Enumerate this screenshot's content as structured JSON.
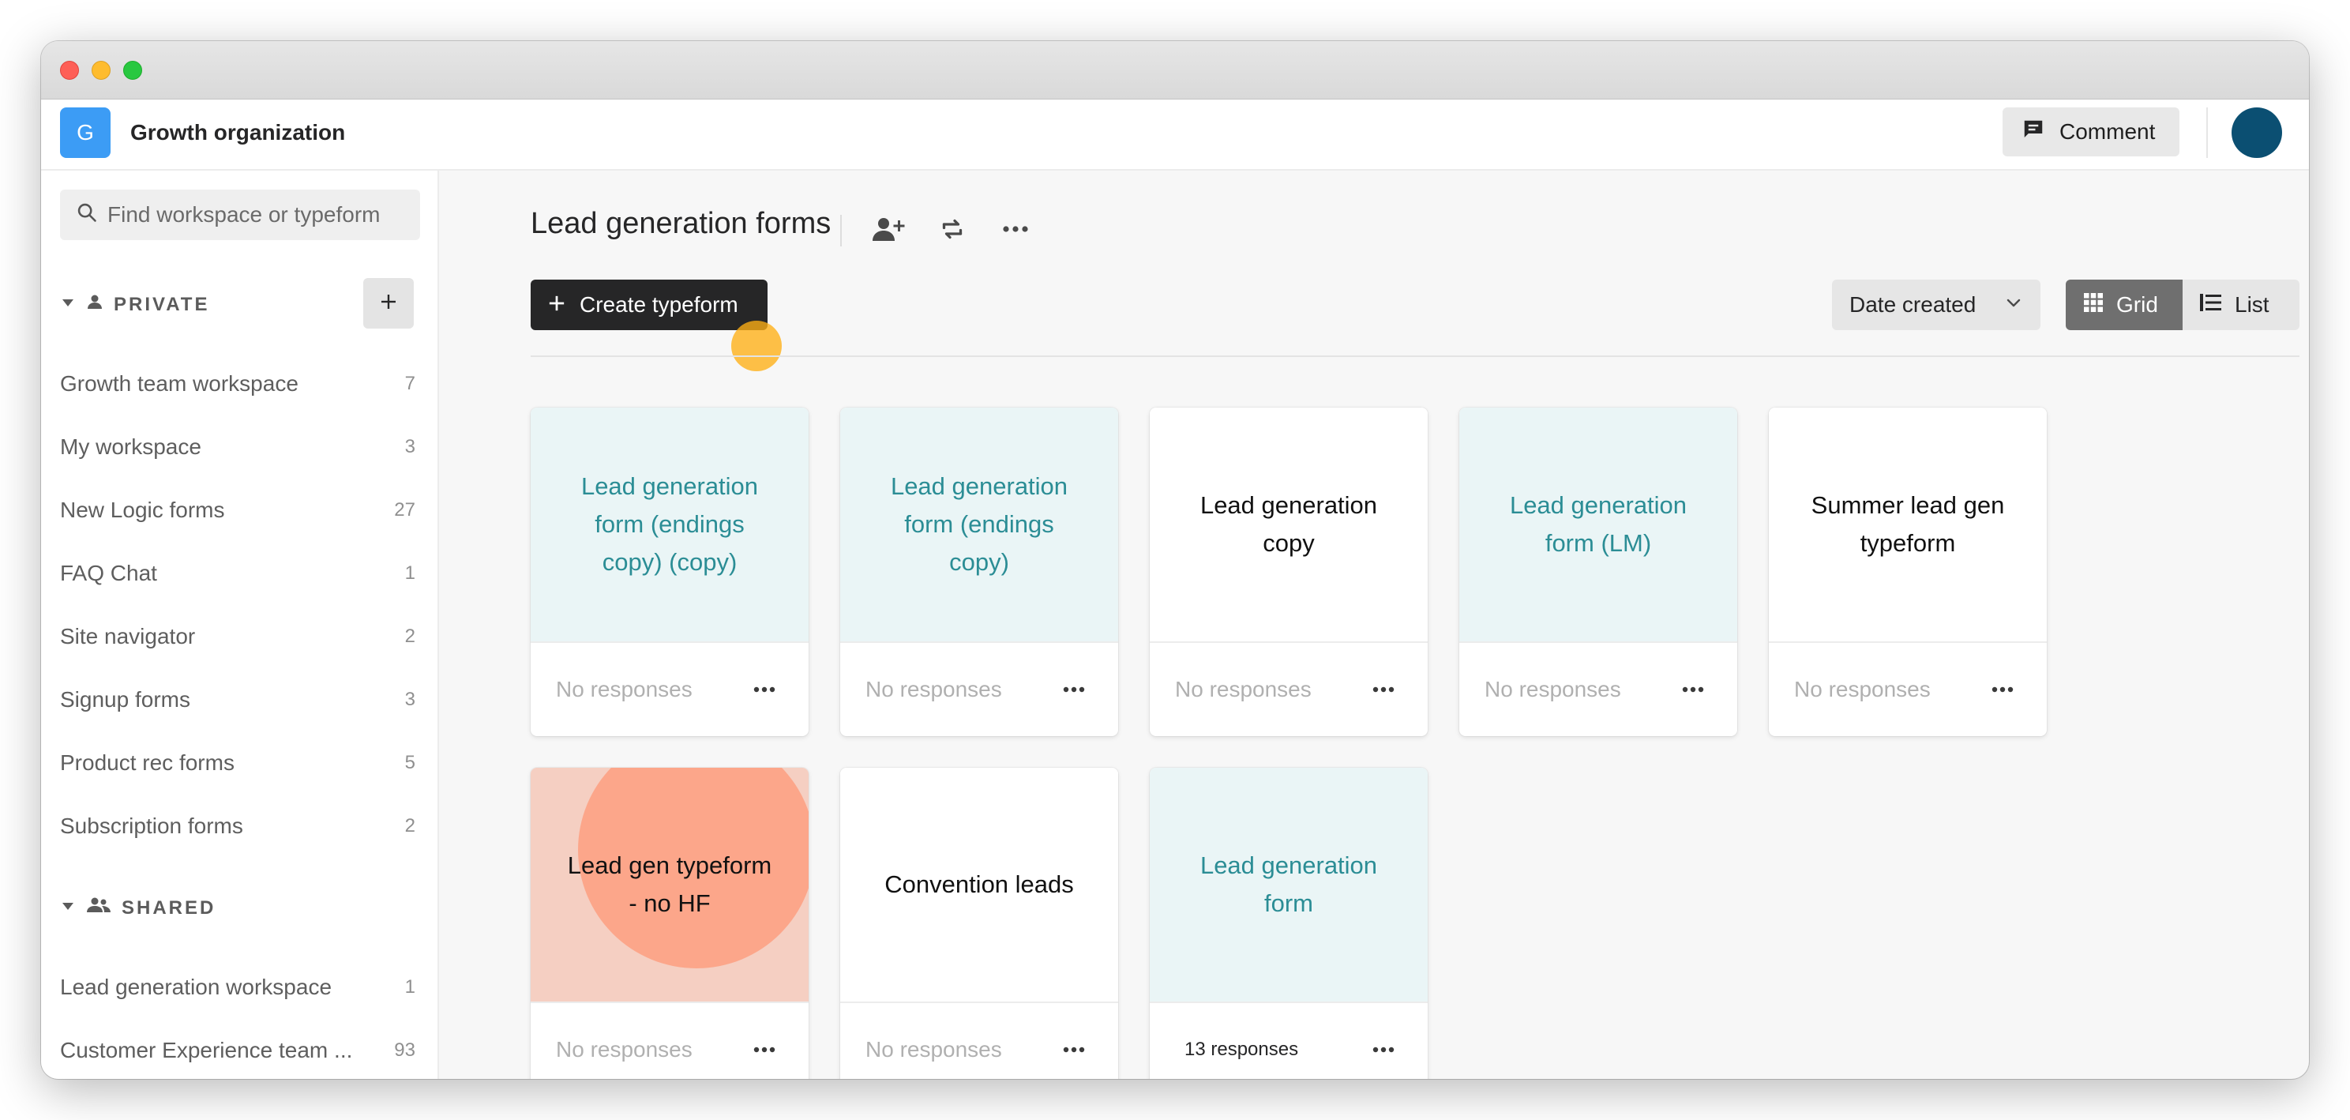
{
  "org": {
    "badge": "G",
    "name": "Growth organization"
  },
  "topbar": {
    "comment_label": "Comment",
    "comment_icon": "comment-icon",
    "avatar_color": "#0b4f72"
  },
  "sidebar": {
    "search_placeholder": "Find workspace or typeform",
    "private_label": "PRIVATE",
    "shared_label": "SHARED",
    "private_items": [
      {
        "label": "Growth team workspace",
        "count": "7"
      },
      {
        "label": "My workspace",
        "count": "3"
      },
      {
        "label": "New Logic forms",
        "count": "27"
      },
      {
        "label": "FAQ Chat",
        "count": "1"
      },
      {
        "label": "Site navigator",
        "count": "2"
      },
      {
        "label": "Signup forms",
        "count": "3"
      },
      {
        "label": "Product rec forms",
        "count": "5"
      },
      {
        "label": "Subscription forms",
        "count": "2"
      }
    ],
    "shared_items": [
      {
        "label": "Lead generation workspace",
        "count": "1"
      },
      {
        "label": "Customer Experience team ...",
        "count": "93"
      }
    ]
  },
  "main": {
    "title": "Lead generation forms",
    "create_label": "Create typeform",
    "sort_label": "Date created",
    "view_grid_label": "Grid",
    "view_list_label": "List",
    "cards": [
      {
        "title": "Lead generation form (endings copy) (copy)",
        "responses": "No responses",
        "style": "teal"
      },
      {
        "title": "Lead generation form (endings copy)",
        "responses": "No responses",
        "style": "teal"
      },
      {
        "title": "Lead generation copy",
        "responses": "No responses",
        "style": "white"
      },
      {
        "title": "Lead generation form (LM)",
        "responses": "No responses",
        "style": "teal"
      },
      {
        "title": "Summer lead gen typeform",
        "responses": "No responses",
        "style": "white"
      },
      {
        "title": "Lead gen typeform - no HF",
        "responses": "No responses",
        "style": "salmon"
      },
      {
        "title": "Convention leads",
        "responses": "No responses",
        "style": "white"
      },
      {
        "title": "Lead generation form",
        "responses": "13 responses",
        "style": "teal"
      }
    ]
  },
  "colors": {
    "accent_dark": "#262627",
    "teal_text": "#2b8d95",
    "teal_bg": "#eaf5f6",
    "salmon_bg": "#f5cfc2",
    "salmon_circle": "#fca68a",
    "org_badge": "#3c9cf5",
    "cursor": "#ffb014"
  }
}
